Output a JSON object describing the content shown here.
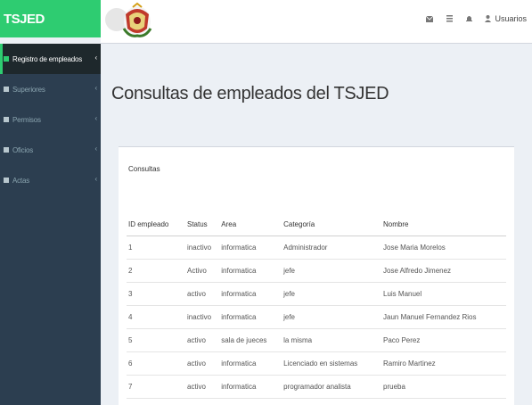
{
  "brand": "TSJED",
  "topbar": {
    "icons": [
      "envelope-icon",
      "list-icon",
      "bell-icon"
    ],
    "user_label": "Usuarios"
  },
  "sidebar": {
    "items": [
      {
        "label": "Registro de empleados",
        "active": true
      },
      {
        "label": "Superiores",
        "active": false
      },
      {
        "label": "Permisos",
        "active": false
      },
      {
        "label": "Oficios",
        "active": false
      },
      {
        "label": "Actas",
        "active": false
      }
    ]
  },
  "main": {
    "title": "Consultas de empleados del TSJED",
    "box_title": "Consultas",
    "table": {
      "headers": [
        "ID empleado",
        "Status",
        "Area",
        "Categoría",
        "Nombre"
      ],
      "rows": [
        [
          "1",
          "inactivo",
          "informatica",
          "Administrador",
          "Jose Maria Morelos"
        ],
        [
          "2",
          "Activo",
          "informatica",
          "jefe",
          "Jose Alfredo Jimenez"
        ],
        [
          "3",
          "activo",
          "informatica",
          "jefe",
          "Luis Manuel"
        ],
        [
          "4",
          "inactivo",
          "informatica",
          "jefe",
          "Jaun Manuel Fernandez Rios"
        ],
        [
          "5",
          "activo",
          "sala de jueces",
          "la misma",
          "Paco Perez"
        ],
        [
          "6",
          "activo",
          "informatica",
          "Licenciado en sistemas",
          "Ramiro Martinez"
        ],
        [
          "7",
          "activo",
          "informatica",
          "programador analista",
          "prueba"
        ]
      ]
    }
  },
  "colors": {
    "brand_green": "#2ecc71",
    "sidebar_bg": "#2c3e50",
    "sidebar_active_bg": "#1e282c",
    "content_bg": "#ecf0f5"
  }
}
